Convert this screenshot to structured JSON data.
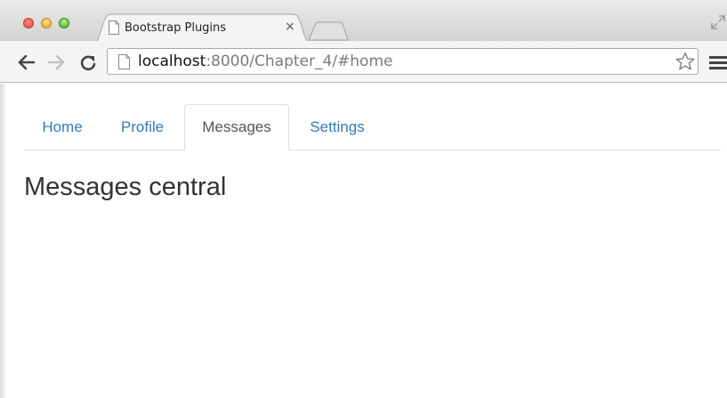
{
  "browser": {
    "tab_title": "Bootstrap Plugins",
    "tab_close_glyph": "×",
    "url_host": "localhost",
    "url_rest": ":8000/Chapter_4/#home",
    "icons": {
      "close": "close-icon",
      "new_tab": "new-tab-icon",
      "back": "back-arrow-icon",
      "forward": "forward-arrow-icon",
      "reload": "reload-icon",
      "page": "page-icon",
      "bookmark": "star-icon",
      "menu": "hamburger-menu-icon",
      "fullscreen": "fullscreen-icon"
    }
  },
  "page": {
    "tabs": [
      {
        "label": "Home",
        "active": false
      },
      {
        "label": "Profile",
        "active": false
      },
      {
        "label": "Messages",
        "active": true
      },
      {
        "label": "Settings",
        "active": false
      }
    ],
    "heading": "Messages central"
  },
  "colors": {
    "link": "#337ab7",
    "active_tab_text": "#555555",
    "heading": "#333333",
    "tab_border": "#dddddd"
  }
}
